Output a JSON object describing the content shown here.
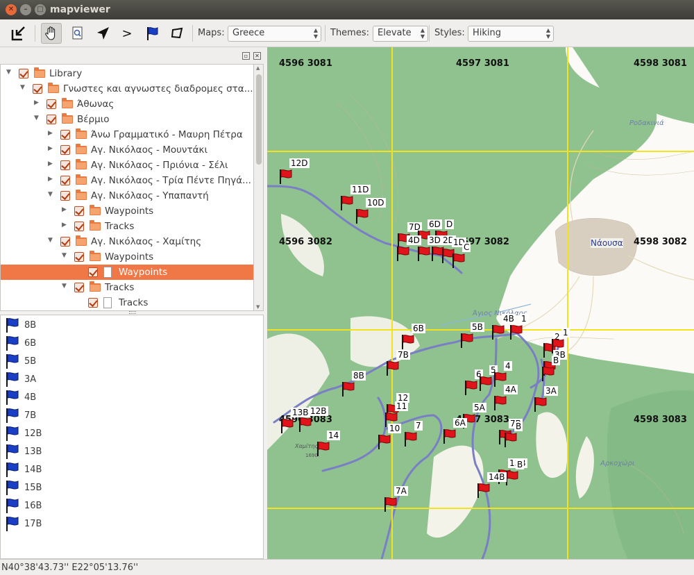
{
  "window": {
    "title": "mapviewer"
  },
  "toolbar": {
    "icons": [
      "export-icon",
      "pan-hand-icon",
      "zoom-page-icon",
      "navigate-arrow-icon",
      "forward-icon",
      "waypoint-flag-icon",
      "area-icon"
    ],
    "forward_glyph": ">",
    "maps_label": "Maps:",
    "maps_value": "Greece",
    "themes_label": "Themes:",
    "themes_value": "Elevate",
    "styles_label": "Styles:",
    "styles_value": "Hiking"
  },
  "tree": [
    {
      "label": "Library",
      "type": "folder",
      "expander": "open",
      "level": 0
    },
    {
      "label": "Γνωστες και αγνωστες διαδρομες στα...",
      "type": "folder",
      "expander": "open",
      "level": 1
    },
    {
      "label": "Άθωνας",
      "type": "folder",
      "expander": "closed",
      "level": 2
    },
    {
      "label": "Βέρμιο",
      "type": "folder",
      "expander": "open",
      "level": 2
    },
    {
      "label": "Άνω Γραμματικό - Μαυρη Πέτρα",
      "type": "folder",
      "expander": "closed",
      "level": 3
    },
    {
      "label": "Αγ. Νικόλαος - Μουντάκι",
      "type": "folder",
      "expander": "closed",
      "level": 3
    },
    {
      "label": "Αγ. Νικόλαος - Πριόνια - Σέλι",
      "type": "folder",
      "expander": "closed",
      "level": 3
    },
    {
      "label": "Αγ. Νικόλαος - Τρία Πέντε Πηγά...",
      "type": "folder",
      "expander": "closed",
      "level": 3
    },
    {
      "label": "Αγ. Νικόλαος - Υπαπαντή",
      "type": "folder",
      "expander": "open",
      "level": 3
    },
    {
      "label": "Waypoints",
      "type": "folder",
      "expander": "closed",
      "level": 4
    },
    {
      "label": "Tracks",
      "type": "folder",
      "expander": "closed",
      "level": 4
    },
    {
      "label": "Αγ. Νικόλαος - Χαμίτης",
      "type": "folder",
      "expander": "open",
      "level": 3
    },
    {
      "label": "Waypoints",
      "type": "folder",
      "expander": "open",
      "level": 4
    },
    {
      "label": "Waypoints",
      "type": "doc",
      "expander": "none",
      "level": 5,
      "selected": true
    },
    {
      "label": "Tracks",
      "type": "folder",
      "expander": "open",
      "level": 4
    },
    {
      "label": "Tracks",
      "type": "doc",
      "expander": "none",
      "level": 5
    }
  ],
  "waypoint_list": [
    "8B",
    "6B",
    "5B",
    "3A",
    "4B",
    "7B",
    "12B",
    "13B",
    "14B",
    "15B",
    "16B",
    "17B"
  ],
  "status": {
    "coordinates": "N40°38'43.73''  E22°05'13.76''"
  },
  "map": {
    "grid_labels": [
      "4596 3081",
      "4597 3081",
      "4598 3081",
      "4596 3082",
      "4597 3082",
      "4598 3082",
      "4596 3083",
      "4597 3083",
      "4598 3083"
    ],
    "places": [
      "Ροδακινιά",
      "Νάουσα",
      "Άγιος Νικόλαος",
      "Αρκοχώρι",
      "Χαμίτης",
      "1690"
    ],
    "waypoints": [
      "12D",
      "11D",
      "10D",
      "7D",
      "6D",
      "D",
      "4D",
      "3D",
      "2D",
      "1D",
      "C",
      "6B",
      "5B",
      "4B",
      "1",
      "2",
      "1",
      "3B",
      "B",
      "7B",
      "8B",
      "6",
      "5",
      "4",
      "4A",
      "3A",
      "12",
      "11",
      "10",
      "7",
      "5A",
      "6A",
      "13B",
      "12B",
      "14",
      "7B",
      "B",
      "13B",
      "B",
      "14B",
      "7A"
    ]
  },
  "colors": {
    "selection": "#f07746",
    "grid": "#f3e21e",
    "forest": "#8fc28f",
    "track": "#7a7ec4",
    "flag_red": "#e0141b",
    "flag_blue": "#1a3fc4"
  }
}
